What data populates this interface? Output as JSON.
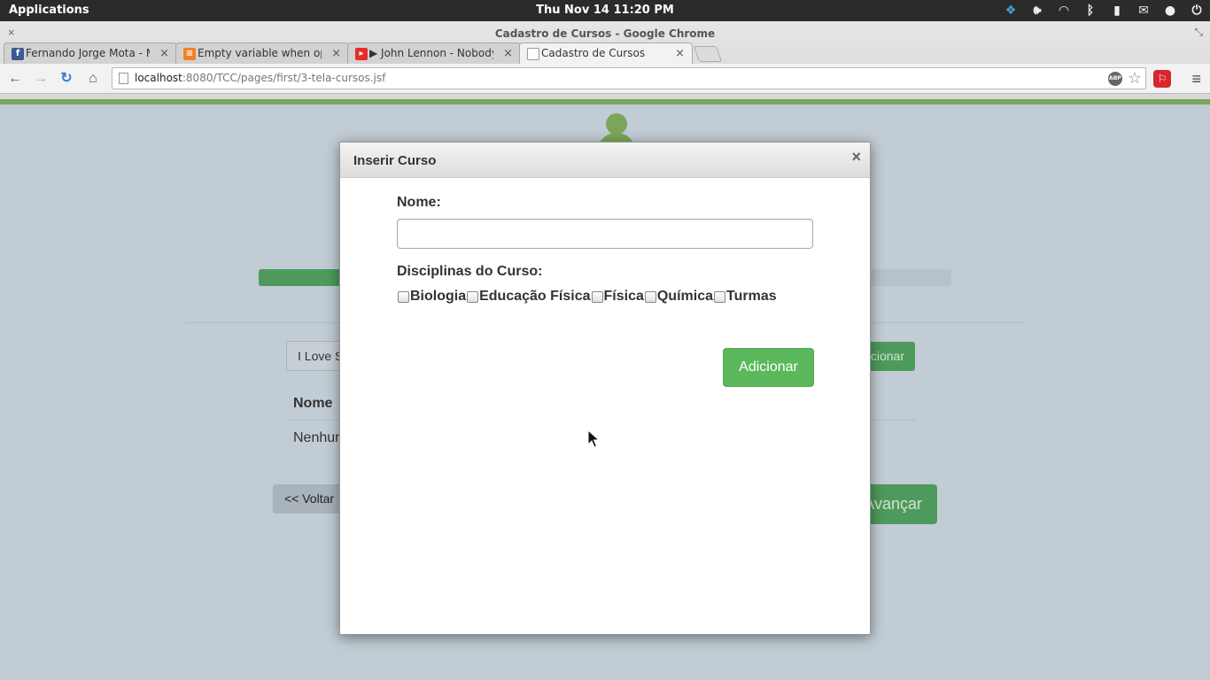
{
  "os_bar": {
    "applications": "Applications",
    "clock": "Thu Nov 14 11:20 PM",
    "tray_icons": [
      "dropbox-icon",
      "volume-icon",
      "wifi-icon",
      "bluetooth-icon",
      "battery-icon",
      "mail-icon",
      "user-icon",
      "power-icon"
    ]
  },
  "browser": {
    "window_title": "Cadastro de Cursos - Google Chrome",
    "tabs": [
      {
        "label": "Fernando Jorge Mota - Mes",
        "icon": "facebook-icon",
        "active": false
      },
      {
        "label": "Empty variable when open",
        "icon": "stackoverflow-icon",
        "active": false
      },
      {
        "label": "▶ John Lennon - Nobody T",
        "icon": "youtube-icon",
        "active": false
      },
      {
        "label": "Cadastro de Cursos",
        "icon": "page-icon",
        "active": true
      }
    ],
    "url_host": "localhost",
    "url_path": ":8080/TCC/pages/first/3-tela-cursos.jsf",
    "abp_label": "ABP"
  },
  "page": {
    "search_value": "I Love S",
    "add_label": "cionar",
    "table_header": "Nome",
    "empty_row": "Nenhur",
    "back_label": "<< Voltar",
    "next_label": "Avançar",
    "progress_fraction": 0.333
  },
  "modal": {
    "title": "Inserir Curso",
    "close": "×",
    "name_label": "Nome:",
    "name_value": "",
    "disciplines_label": "Disciplinas do Curso:",
    "disciplines": [
      {
        "label": "Biologia",
        "checked": false
      },
      {
        "label": "Educação Física",
        "checked": false
      },
      {
        "label": "Física",
        "checked": false
      },
      {
        "label": "Química",
        "checked": false
      },
      {
        "label": "Turmas",
        "checked": false
      }
    ],
    "submit_label": "Adicionar"
  },
  "colors": {
    "accent_green": "#5cb85c",
    "page_green": "#7aa65a",
    "overlay_bg": "#c2ccd4"
  }
}
